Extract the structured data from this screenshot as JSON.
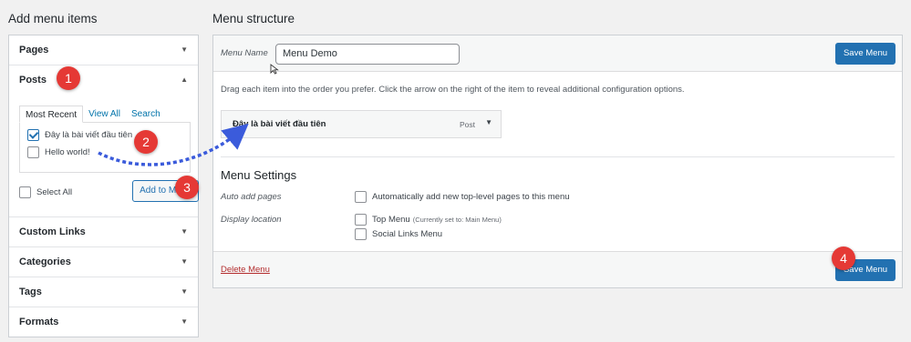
{
  "left": {
    "title": "Add menu items",
    "sections": {
      "pages": "Pages",
      "posts": "Posts",
      "custom_links": "Custom Links",
      "categories": "Categories",
      "tags": "Tags",
      "formats": "Formats"
    },
    "tabs": [
      "Most Recent",
      "View All",
      "Search"
    ],
    "posts": [
      {
        "label": "Đây là bài viết đầu tiên",
        "checked": true
      },
      {
        "label": "Hello world!",
        "checked": false
      }
    ],
    "select_all": "Select All",
    "add_button": "Add to Menu"
  },
  "right": {
    "title": "Menu structure",
    "menu_name_label": "Menu Name",
    "menu_name_value": "Menu Demo",
    "save_label": "Save Menu",
    "instructions": "Drag each item into the order you prefer. Click the arrow on the right of the item to reveal additional configuration options.",
    "menu_item": {
      "title": "Đây là bài viết đầu tiên",
      "type": "Post"
    },
    "settings": {
      "title": "Menu Settings",
      "auto_add_label": "Auto add pages",
      "auto_add_option": "Automatically add new top-level pages to this menu",
      "display_location_label": "Display location",
      "top_menu": "Top Menu",
      "top_menu_note": "(Currently set to: Main Menu)",
      "social_menu": "Social Links Menu"
    },
    "delete_label": "Delete Menu"
  },
  "annotations": [
    "1",
    "2",
    "3",
    "4"
  ],
  "colors": {
    "accent": "#2271b1",
    "badge": "#e53935",
    "delete": "#b32d2e",
    "arrow": "#3b5bdb"
  }
}
